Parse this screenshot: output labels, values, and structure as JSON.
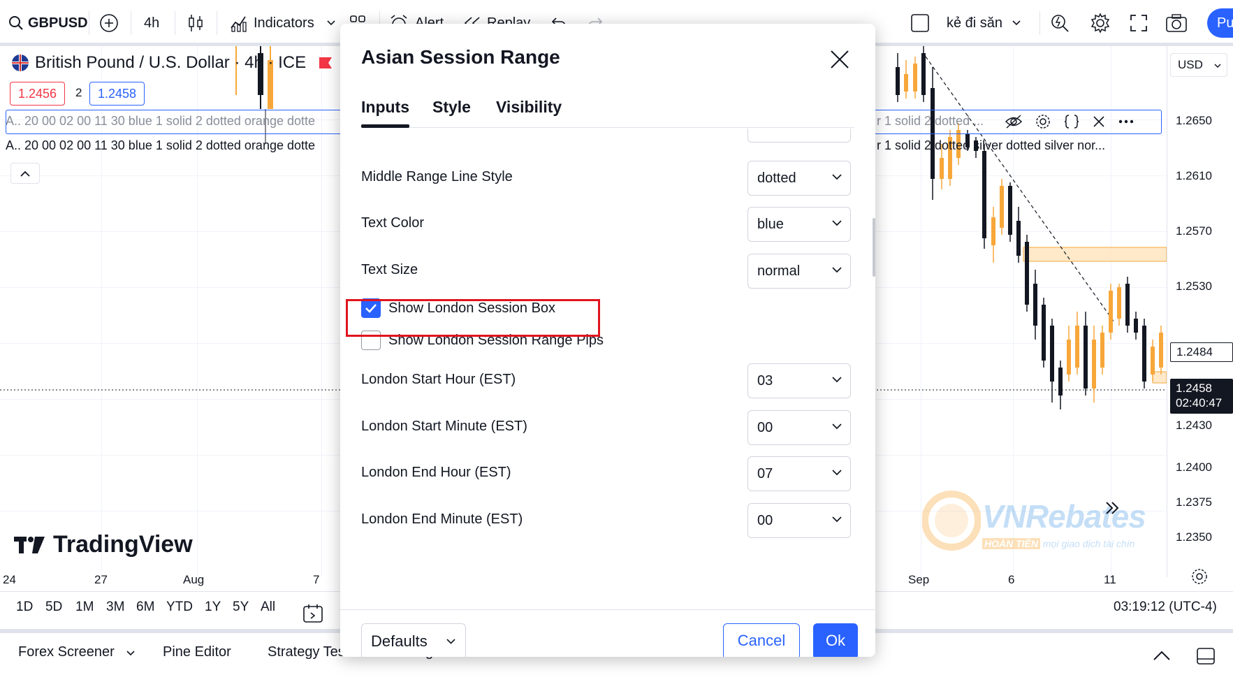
{
  "toolbar": {
    "symbol": "GBPUSD",
    "interval": "4h",
    "indicators_label": "Indicators",
    "alert_label": "Alert",
    "replay_label": "Replay",
    "layout_name": "kẻ đi săn",
    "publish_label": "Pu"
  },
  "chart": {
    "symbol_title": "British Pound / U.S. Dollar · 4h · ICE",
    "bid": "1.2456",
    "spread": "2",
    "ask": "1.2458",
    "indicator_line_1_left": "A.. 20 00 02 00 11 30 blue 1 solid 2 dotted orange dotte",
    "indicator_line_1_right": "r 1 solid 2 dotted ...",
    "indicator_line_2_left": "A.. 20 00 02 00 11 30 blue 1 solid 2 dotted orange dotte",
    "indicator_line_2_right": "r 1 solid 2 dotted silver dotted silver nor...",
    "currency": "USD",
    "price_labels": [
      "1.2650",
      "1.2610",
      "1.2570",
      "1.2530",
      "1.2430",
      "1.2400",
      "1.2375",
      "1.2350"
    ],
    "last_price_tag": "1.2484",
    "current_price": "1.2458",
    "countdown": "02:40:47",
    "time_labels": [
      "24",
      "27",
      "Aug",
      "7",
      "Sep",
      "6",
      "11"
    ],
    "logo_text": "TradingView",
    "watermark_text": "VNRebates",
    "watermark_sub_left": "HOÀN TIỀN",
    "watermark_sub": "mọi giao dịch tài chín"
  },
  "range_bar": {
    "ranges": [
      "1D",
      "5D",
      "1M",
      "3M",
      "6M",
      "YTD",
      "1Y",
      "5Y",
      "All"
    ],
    "clock": "03:19:12 (UTC-4)"
  },
  "panel_bar": {
    "items": [
      "Forex Screener",
      "Pine Editor",
      "Strategy Tester",
      "Trading Panel"
    ]
  },
  "dialog": {
    "title": "Asian Session Range",
    "tabs": [
      "Inputs",
      "Style",
      "Visibility"
    ],
    "rows": {
      "middle_line_style": {
        "label": "Middle Range Line Style",
        "value": "dotted"
      },
      "text_color": {
        "label": "Text Color",
        "value": "blue"
      },
      "text_size": {
        "label": "Text Size",
        "value": "normal"
      },
      "show_london_box": {
        "label": "Show London Session Box",
        "checked": true
      },
      "show_london_pips": {
        "label": "Show London Session Range Pips",
        "checked": false
      },
      "london_start_hour": {
        "label": "London Start Hour (EST)",
        "value": "03"
      },
      "london_start_minute": {
        "label": "London Start Minute (EST)",
        "value": "00"
      },
      "london_end_hour": {
        "label": "London End Hour (EST)",
        "value": "07"
      },
      "london_end_minute": {
        "label": "London End Minute (EST)",
        "value": "00"
      }
    },
    "defaults_label": "Defaults",
    "cancel_label": "Cancel",
    "ok_label": "Ok"
  },
  "colors": {
    "accent": "#2962ff",
    "highlight": "#e0141e",
    "bull": "#f7a73a",
    "bear": "#131722"
  }
}
